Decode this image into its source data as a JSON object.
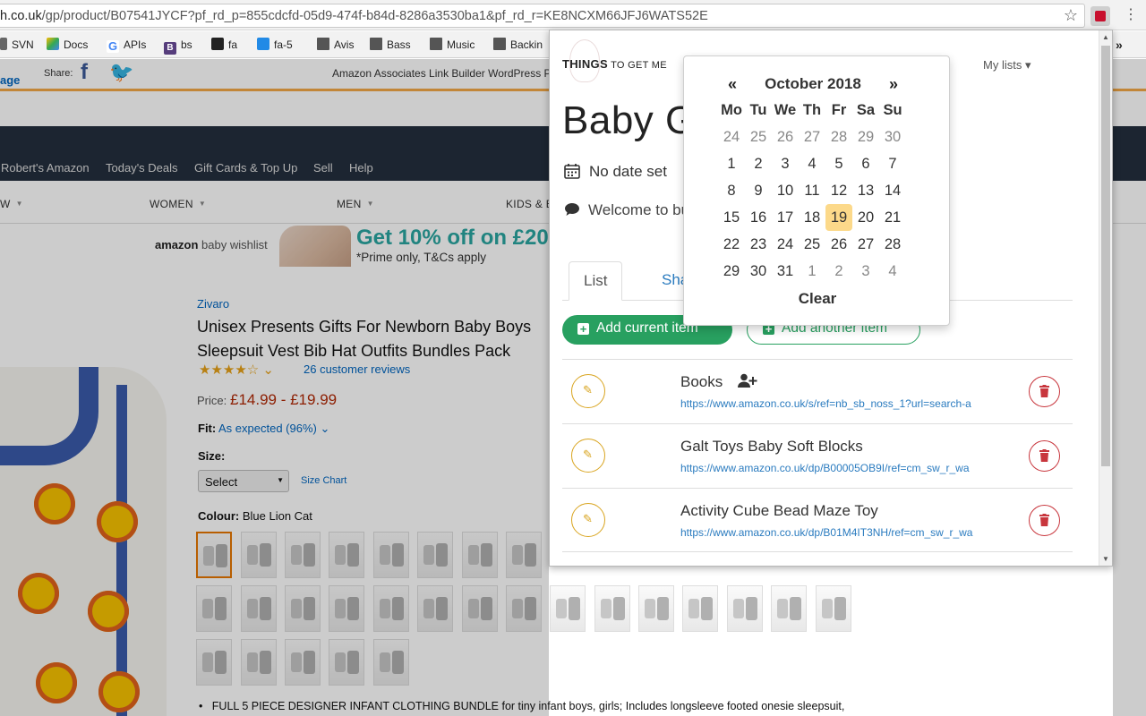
{
  "browser": {
    "url_prefix": "h.co.uk",
    "url_rest": "/gp/product/B07541JYCF?pf_rd_p=855cdcfd-05d9-474f-b84d-8286a3530ba1&pf_rd_r=KE8NCXM66JFJ6WATS52E",
    "bookmarks": [
      "SVN",
      "Docs",
      "APIs",
      "bs",
      "fa",
      "fa-5",
      "Avis",
      "Bass",
      "Music",
      "Backin"
    ],
    "bookmark_overflow": "»",
    "star_icon": "star-icon",
    "menu_icon": "⋮"
  },
  "amazon": {
    "page_link": "age",
    "share_label": "Share:",
    "assoc_text": "Amazon Associates Link Builder WordPress P",
    "nav_links": [
      "Robert's Amazon",
      "Today's Deals",
      "Gift Cards & Top Up",
      "Sell",
      "Help"
    ],
    "categories": [
      "W",
      "WOMEN",
      "MEN",
      "KIDS & B"
    ],
    "banner": {
      "logo_bold": "amazon",
      "logo_rest": " baby wishlist",
      "offer": "Get 10% off on £200",
      "sub": "*Prime only, T&Cs apply"
    },
    "product": {
      "brand": "Zivaro",
      "title": "Unisex Presents Gifts For Newborn Baby Boys Sleepsuit Vest Bib Hat Outfits Bundles Pack",
      "stars": "★★★★☆ ⌄",
      "reviews": "26 customer reviews",
      "price_label": "Price:",
      "price": "£14.99 - £19.99",
      "fit_label": "Fit:",
      "fit_value": "As expected (96%) ⌄",
      "size_label": "Size:",
      "size_select": "Select",
      "size_chart": "Size Chart",
      "colour_label": "Colour:",
      "colour_value": "Blue Lion Cat",
      "bullet": "FULL 5 PIECE DESIGNER INFANT CLOTHING BUNDLE for tiny infant boys, girls; Includes longsleeve footed onesie sleepsuit,"
    }
  },
  "popup": {
    "logo_bold": "THINGS",
    "logo_rest": " TO GET ME",
    "my_lists": "My lists ▾",
    "list_title": "Baby G",
    "date_text": "No date set",
    "welcome": "Welcome to                                                   buy anything, just your pre                                                   n.",
    "tabs": [
      "List",
      "Shar"
    ],
    "add_current": "Add current item",
    "add_another": "Add another item",
    "items": [
      {
        "name": "Books",
        "url": "https://www.amazon.co.uk/s/ref=nb_sb_noss_1?url=search-a"
      },
      {
        "name": "Galt Toys Baby Soft Blocks",
        "url": "https://www.amazon.co.uk/dp/B00005OB9I/ref=cm_sw_r_wa"
      },
      {
        "name": "Activity Cube Bead Maze Toy",
        "url": "https://www.amazon.co.uk/dp/B01M4IT3NH/ref=cm_sw_r_wa"
      }
    ]
  },
  "datepicker": {
    "prev": "«",
    "next": "»",
    "title": "October 2018",
    "dow": [
      "Mo",
      "Tu",
      "We",
      "Th",
      "Fr",
      "Sa",
      "Su"
    ],
    "weeks": [
      [
        "24",
        "25",
        "26",
        "27",
        "28",
        "29",
        "30"
      ],
      [
        "1",
        "2",
        "3",
        "4",
        "5",
        "6",
        "7"
      ],
      [
        "8",
        "9",
        "10",
        "11",
        "12",
        "13",
        "14"
      ],
      [
        "15",
        "16",
        "17",
        "18",
        "19",
        "20",
        "21"
      ],
      [
        "22",
        "23",
        "24",
        "25",
        "26",
        "27",
        "28"
      ],
      [
        "29",
        "30",
        "31",
        "1",
        "2",
        "3",
        "4"
      ]
    ],
    "muted_first_row": true,
    "muted_last_row_from": 3,
    "today": "19",
    "clear": "Clear"
  },
  "colors": {
    "accent_green": "#28a060",
    "edit_yellow": "#d9a520",
    "delete_red": "#c8363d",
    "link_blue": "#2a7bbf",
    "today_highlight": "#fcd98a"
  }
}
